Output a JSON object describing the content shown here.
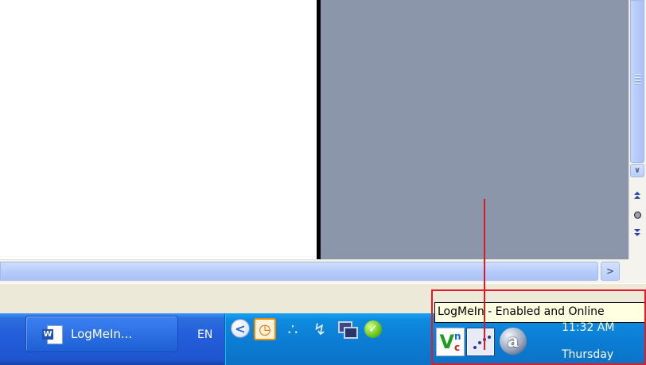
{
  "scrollbar": {
    "down_arrow": "∨",
    "prev_page": "↕",
    "select_browse_object": "○",
    "next_page": "↓",
    "right_arrow": ">"
  },
  "tooltip": {
    "text": "LogMeIn - Enabled and Online"
  },
  "taskbar": {
    "task_button_label": "LogMeIn...",
    "word_icon_letter": "W",
    "language": "EN",
    "chevron": "<"
  },
  "tray": {
    "icons": [
      "clock-icon",
      "network-icon",
      "stethoscope-icon",
      "monitors-icon",
      "shield-icon",
      "vnc-icon",
      "logmein-icon",
      "a-icon"
    ],
    "vnc_letters": {
      "v": "V",
      "n": "n",
      "c": "c"
    },
    "a_letter": "a",
    "clock_time": "11:32 AM",
    "clock_day": "Thursday"
  },
  "colors": {
    "doc_gray": "#8c96aa",
    "taskbar_blue": "#245edb",
    "tray_blue": "#0b7ed5",
    "highlight_red": "#e11d24",
    "tooltip_bg": "#ffffe1"
  }
}
